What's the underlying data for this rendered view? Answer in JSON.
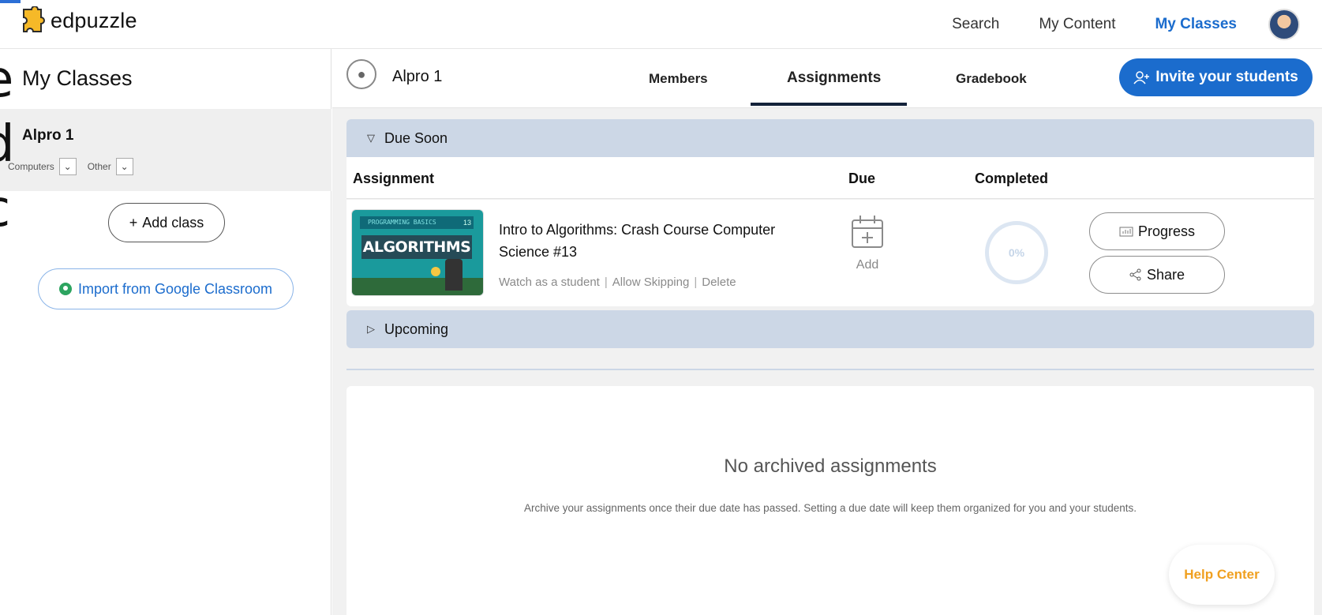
{
  "app": {
    "logo_text": "edpuzzle"
  },
  "topnav": {
    "search": "Search",
    "my_content": "My Content",
    "my_classes": "My Classes"
  },
  "slide_overlay": {
    "letters": [
      "e",
      "d",
      "c",
      "/"
    ]
  },
  "sidebar": {
    "title": "My Classes",
    "class": {
      "name": "Alpro 1",
      "tag1": "Computers",
      "tag2": "Other"
    },
    "add_class": "Add class",
    "import_google": "Import from Google Classroom"
  },
  "header": {
    "class_name": "Alpro 1",
    "tabs": {
      "members": "Members",
      "assignments": "Assignments",
      "gradebook": "Gradebook"
    },
    "invite": "Invite your students"
  },
  "due_soon": {
    "label": "Due Soon",
    "columns": {
      "assignment": "Assignment",
      "due": "Due",
      "completed": "Completed"
    },
    "row": {
      "thumb_band": "PROGRAMMING BASICS",
      "thumb_num": "13",
      "thumb_title": "ALGORITHMS",
      "title": "Intro to Algorithms: Crash Course Computer Science #13",
      "actions": [
        "Watch as a student",
        "Allow Skipping",
        "Delete"
      ],
      "due_add": "Add",
      "completed": "0%",
      "completed_fraction": 0,
      "progress": "Progress",
      "share": "Share"
    }
  },
  "upcoming": {
    "label": "Upcoming"
  },
  "archive": {
    "title": "No archived assignments",
    "subtitle": "Archive your assignments once their due date has passed. Setting a due date will keep them organized for you and your students."
  },
  "help": {
    "label": "Help Center"
  },
  "colors": {
    "accent": "#1b6ccd",
    "section": "#ccd7e6",
    "help": "#f0a020"
  }
}
